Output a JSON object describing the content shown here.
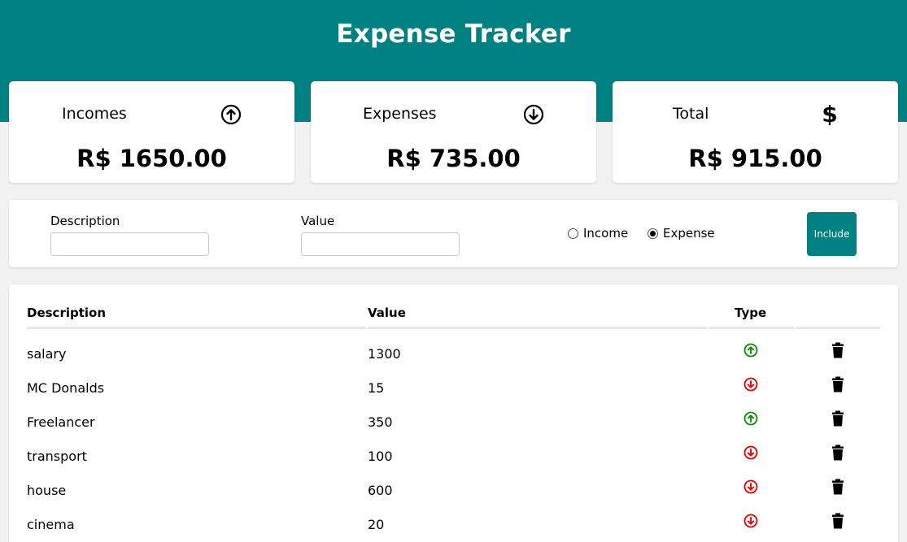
{
  "app": {
    "title": "Expense Tracker"
  },
  "summary": {
    "incomes": {
      "label": "Incomes",
      "value": "R$ 1650.00",
      "icon": "arrow-up-circle-icon"
    },
    "expenses": {
      "label": "Expenses",
      "value": "R$ 735.00",
      "icon": "arrow-down-circle-icon"
    },
    "total": {
      "label": "Total",
      "value": "R$ 915.00",
      "icon": "dollar-sign-icon",
      "symbol": "$"
    }
  },
  "form": {
    "description_label": "Description",
    "description_value": "",
    "value_label": "Value",
    "value_value": "",
    "radio_income_label": "Income",
    "radio_expense_label": "Expense",
    "selected_type": "Expense",
    "include_label": "Include"
  },
  "table": {
    "headers": [
      "Description",
      "Value",
      "Type",
      ""
    ],
    "rows": [
      {
        "description": "salary",
        "value": "1300",
        "type": "income"
      },
      {
        "description": "MC Donalds",
        "value": "15",
        "type": "expense"
      },
      {
        "description": "Freelancer",
        "value": "350",
        "type": "income"
      },
      {
        "description": "transport",
        "value": "100",
        "type": "expense"
      },
      {
        "description": "house",
        "value": "600",
        "type": "expense"
      },
      {
        "description": "cinema",
        "value": "20",
        "type": "expense"
      }
    ]
  },
  "colors": {
    "brand": "#008080",
    "income": "#0a8a0a",
    "expense": "#e60000",
    "background": "#f2f2f2"
  }
}
